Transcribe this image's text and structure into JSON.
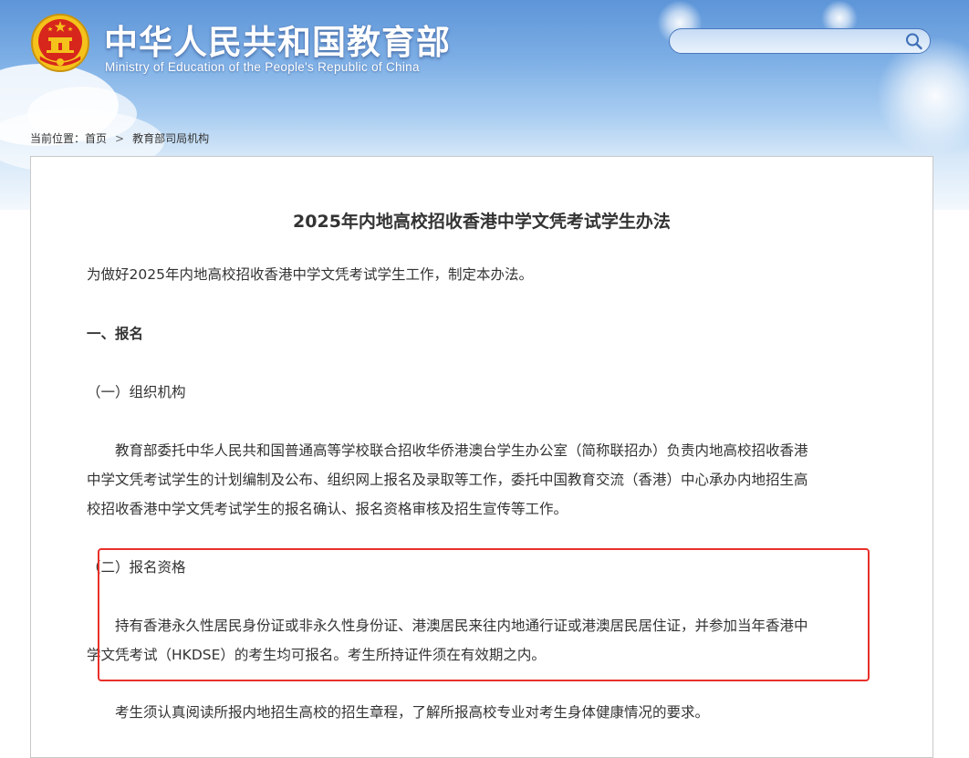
{
  "header": {
    "title": "中华人民共和国教育部",
    "subtitle": "Ministry of Education of the People's Republic of China",
    "search_placeholder": "",
    "search_value": ""
  },
  "breadcrumb": {
    "prefix": "当前位置：",
    "home": "首页",
    "separator": ">",
    "current": "教育部司局机构"
  },
  "article": {
    "title": "2025年内地高校招收香港中学文凭考试学生办法",
    "intro": "为做好2025年内地高校招收香港中学文凭考试学生工作，制定本办法。",
    "section1_heading": "一、报名",
    "sub1_heading": "（一）组织机构",
    "sub1_body": "教育部委托中华人民共和国普通高等学校联合招收华侨港澳台学生办公室（简称联招办）负责内地高校招收香港中学文凭考试学生的计划编制及公布、组织网上报名及录取等工作，委托中国教育交流（香港）中心承办内地招生高校招收香港中学文凭考试学生的报名确认、报名资格审核及招生宣传等工作。",
    "sub2_heading": "（二）报名资格",
    "sub2_body": "持有香港永久性居民身份证或非永久性身份证、港澳居民来往内地通行证或港澳居民居住证，并参加当年香港中学文凭考试（HKDSE）的考生均可报名。考生所持证件须在有效期之内。",
    "note": "考生须认真阅读所报内地招生高校的招生章程，了解所报高校专业对考生身体健康情况的要求。"
  },
  "icons": {
    "emblem": "national-emblem-icon",
    "search": "search-icon"
  },
  "colors": {
    "highlight_border": "#e8302a",
    "emblem_red": "#d7261c",
    "emblem_gold": "#f5c21b"
  }
}
